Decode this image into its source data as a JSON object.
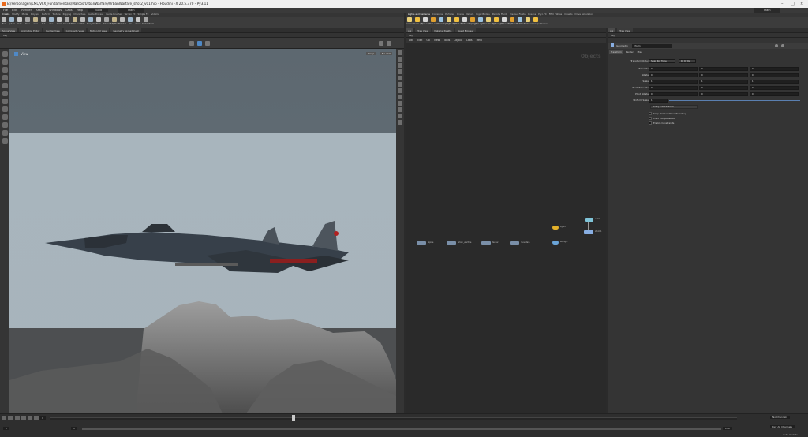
{
  "window": {
    "title": "E:/Personagen/LML/VFX_Fundamentals/Marcos/UrbanWarfare/UrbanWarfare_shot2_v01.hip - Houdini FX 20.5.370 - Py3.11",
    "icon_name": "houdini-icon"
  },
  "menubar": {
    "items": [
      "File",
      "Edit",
      "Render",
      "Assets",
      "Windows",
      "Labs",
      "Help"
    ],
    "build": "Build",
    "desktop": "Main",
    "right_desktop": "Main"
  },
  "shelf_left": {
    "tabs": [
      "Create",
      "Modify",
      "Model",
      "Polygon",
      "Deform",
      "Texture",
      "Rigging",
      "Characters",
      "Guide Process",
      "Guide Brushes",
      "Terrain FX",
      "Simple FX",
      "Volume"
    ],
    "tools": [
      "Box",
      "Sphere",
      "Tube",
      "Torus",
      "Grid",
      "Null",
      "Line",
      "Circle",
      "Curve Bezier",
      "Draw Curve",
      "Path",
      "Spray Paint",
      "Font",
      "Platonic Solids",
      "L-System",
      "Metaball",
      "File",
      "Spray",
      "Sketch Brush"
    ]
  },
  "shelf_right": {
    "tabs": [
      "Lights and Cameras",
      "Collisions",
      "Particles",
      "Grains",
      "Vellum",
      "Rigid Bodies",
      "Particle Fluids",
      "Viscous Fluids",
      "Oceans",
      "Pyro FX",
      "FEM",
      "Wires",
      "Crowds",
      "Drive Simulation"
    ],
    "tools": [
      "Camera",
      "Point Light",
      "Spot Light",
      "Area Light",
      "Geometry Light",
      "Volume Light",
      "Distant Light",
      "Environment Light",
      "Sky Light",
      "GI Light",
      "Caustic Light",
      "Portal Light",
      "Ambient Light",
      "Stereo Camera",
      "VR Camera",
      "Switcher",
      "Gamepad Camera"
    ]
  },
  "viewport": {
    "tabs": [
      "Scene View",
      "Animation Editor",
      "Render View",
      "Composite View",
      "Motion FX View",
      "Geometry Spreadsheet"
    ],
    "path": "obj",
    "label": "View",
    "persp_label": "Persp",
    "camera_label": "No cam"
  },
  "network": {
    "tabs": [
      "obj",
      "Tree View",
      "Material Palette",
      "Asset Browser"
    ],
    "path": "obj",
    "menu": [
      "Add",
      "Edit",
      "Go",
      "View",
      "Tools",
      "Layout",
      "Labs",
      "Help"
    ],
    "context_label": "Objects",
    "nodes": [
      {
        "label": "alpine",
        "color": "#7a8fa8"
      },
      {
        "label": "urban_warfare",
        "color": "#7a8fa8"
      },
      {
        "label": "tanker",
        "color": "#7a8fa8"
      },
      {
        "label": "mountain",
        "color": "#7a8fa8"
      },
      {
        "label": "light1",
        "color": "#e4b12a"
      },
      {
        "label": "keylight",
        "color": "#6aa4d8"
      },
      {
        "label": "cam1",
        "color": "#7fc4d8"
      },
      {
        "label": "xform1",
        "color": "#88aee2"
      }
    ]
  },
  "params": {
    "tabs": [
      "obj",
      "Tree View"
    ],
    "path": "obj",
    "node_type": "Geometry",
    "node_name": "xform",
    "subtabs": [
      "Transform",
      "Render",
      "Misc"
    ],
    "transform_order_label": "Transform Order",
    "transform_order_value": "Scale Rot Trans",
    "rotate_order_value": "Rx Ry Rz",
    "rows": [
      {
        "label": "Translate",
        "values": [
          "0",
          "0",
          "0"
        ]
      },
      {
        "label": "Rotate",
        "values": [
          "0",
          "0",
          "0"
        ]
      },
      {
        "label": "Scale",
        "values": [
          "1",
          "1",
          "1"
        ]
      },
      {
        "label": "Pivot Translate",
        "values": [
          "0",
          "0",
          "0"
        ]
      },
      {
        "label": "Pivot Rotate",
        "values": [
          "0",
          "0",
          "0"
        ]
      }
    ],
    "uniform_scale_label": "Uniform Scale",
    "uniform_scale_value": "1",
    "modify_button": "Modify Pre-Transform",
    "checkboxes": [
      "Keep Position When Parenting",
      "Child Compensation",
      "Enable Constraints"
    ]
  },
  "timeline": {
    "current_frame": "1",
    "start_frame": "1",
    "end_frame": "240",
    "range_end": "240",
    "fps_label": "24 fps",
    "channels_label": "No Channels",
    "keys_label": "Key All Channels",
    "status_label": "Auto Update"
  }
}
